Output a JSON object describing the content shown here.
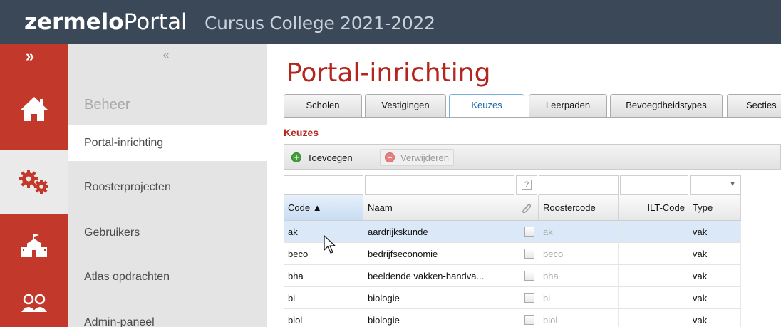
{
  "header": {
    "brand_bold": "zermelo",
    "brand_rest": "Portal",
    "school": "Cursus College 2021-2022",
    "bg_color": "#3b4857"
  },
  "rail": {
    "expand_glyph": "»",
    "icons": [
      "home-icon",
      "gears-icon",
      "school-icon",
      "people-icon"
    ],
    "accent_color": "#c2392b"
  },
  "menu": {
    "collapse_glyph": "«",
    "heading": "Beheer",
    "items": [
      {
        "label": "Portal-inrichting",
        "active": true
      },
      {
        "label": "Roosterprojecten",
        "active": false
      },
      {
        "label": "Gebruikers",
        "active": false
      },
      {
        "label": "Atlas opdrachten",
        "active": false
      },
      {
        "label": "Admin-paneel",
        "active": false
      }
    ]
  },
  "main": {
    "title": "Portal-inrichting",
    "tabs": [
      {
        "label": "Scholen"
      },
      {
        "label": "Vestigingen"
      },
      {
        "label": "Keuzes",
        "active": true
      },
      {
        "label": "Leerpaden"
      },
      {
        "label": "Bevoegdheidstypes"
      },
      {
        "label": "Secties"
      }
    ],
    "section_title": "Keuzes",
    "toolbar": {
      "add_label": "Toevoegen",
      "delete_label": "Verwijderen"
    },
    "grid": {
      "filter_help": "?",
      "columns": [
        {
          "label": "Code ▲"
        },
        {
          "label": "Naam"
        },
        {
          "label": ""
        },
        {
          "label": "Roostercode"
        },
        {
          "label": "ILT-Code"
        },
        {
          "label": "Type"
        }
      ],
      "rows": [
        {
          "code": "ak",
          "naam": "aardrijkskunde",
          "roostercode": "ak",
          "ilt": "",
          "type": "vak",
          "selected": true
        },
        {
          "code": "beco",
          "naam": "bedrijfseconomie",
          "roostercode": "beco",
          "ilt": "",
          "type": "vak"
        },
        {
          "code": "bha",
          "naam": "beeldende vakken-handva...",
          "roostercode": "bha",
          "ilt": "",
          "type": "vak"
        },
        {
          "code": "bi",
          "naam": "biologie",
          "roostercode": "bi",
          "ilt": "",
          "type": "vak"
        },
        {
          "code": "biol",
          "naam": "biologie",
          "roostercode": "biol",
          "ilt": "",
          "type": "vak"
        }
      ]
    }
  }
}
